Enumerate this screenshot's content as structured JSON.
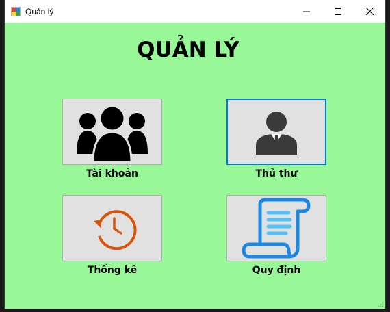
{
  "window": {
    "title": "Quản lý",
    "icon": "app-window-icon"
  },
  "titlebar_buttons": {
    "minimize": "minimize-icon",
    "maximize": "maximize-icon",
    "close": "close-icon"
  },
  "main": {
    "heading": "QUẢN LÝ",
    "tiles": [
      {
        "label": "Tài khoản",
        "icon": "users-group-icon"
      },
      {
        "label": "Thủ thư",
        "icon": "librarian-icon"
      },
      {
        "label": "Thống kê",
        "icon": "history-clock-icon"
      },
      {
        "label": "Quy định",
        "icon": "scroll-document-icon"
      }
    ]
  },
  "colors": {
    "background": "#98f898",
    "tile": "#e1e1e1",
    "focus_border": "#0078d7",
    "clock_orange": "#d9530b",
    "scroll_blue": "#1e88e5",
    "scroll_lines": "#4fc3f7"
  }
}
